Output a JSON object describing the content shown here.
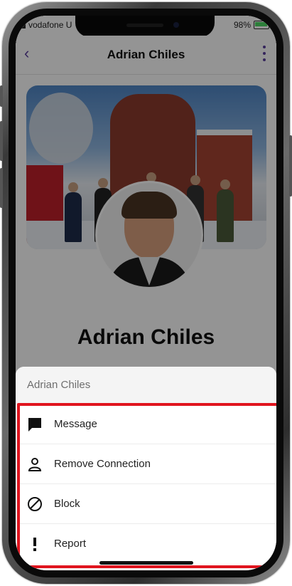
{
  "status_bar": {
    "carrier": "vodafone U",
    "battery": "98%"
  },
  "header": {
    "title": "Adrian Chiles",
    "back_icon": "chevron-left-icon",
    "more_icon": "kebab-icon"
  },
  "profile": {
    "name": "Adrian Chiles"
  },
  "sheet": {
    "title": "Adrian Chiles",
    "items": [
      {
        "label": "Message",
        "icon": "message-icon"
      },
      {
        "label": "Remove Connection",
        "icon": "person-icon"
      },
      {
        "label": "Block",
        "icon": "block-icon"
      },
      {
        "label": "Report",
        "icon": "exclamation-icon"
      }
    ]
  },
  "colors": {
    "accent": "#5b3f9e",
    "highlight": "#e0141e"
  }
}
